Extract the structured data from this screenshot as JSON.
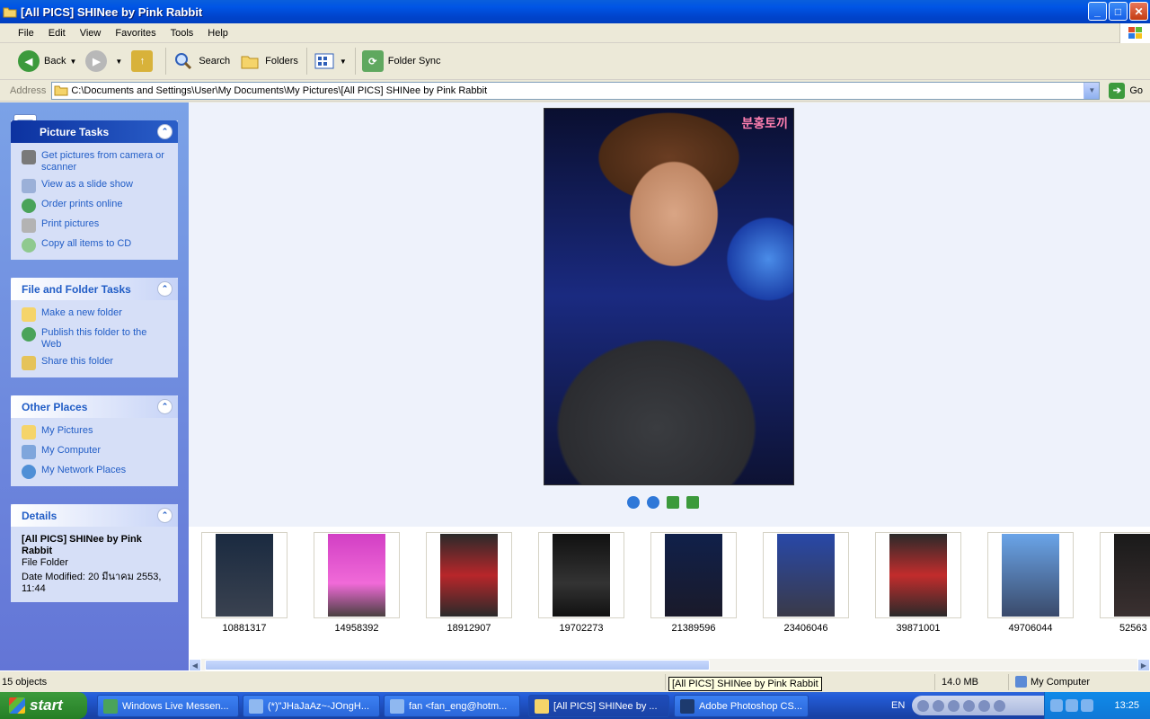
{
  "window": {
    "title": "[All PICS] SHINee by Pink Rabbit"
  },
  "menu": [
    "File",
    "Edit",
    "View",
    "Favorites",
    "Tools",
    "Help"
  ],
  "toolbar": {
    "back": "Back",
    "search": "Search",
    "folders": "Folders",
    "folder_sync": "Folder Sync"
  },
  "address": {
    "label": "Address",
    "path": "C:\\Documents and Settings\\User\\My Documents\\My Pictures\\[All PICS] SHINee by Pink Rabbit",
    "go": "Go"
  },
  "tasks": {
    "picture": {
      "title": "Picture Tasks",
      "items": [
        "Get pictures from camera or scanner",
        "View as a slide show",
        "Order prints online",
        "Print pictures",
        "Copy all items to CD"
      ]
    },
    "file_folder": {
      "title": "File and Folder Tasks",
      "items": [
        "Make a new folder",
        "Publish this folder to the Web",
        "Share this folder"
      ]
    },
    "other": {
      "title": "Other Places",
      "items": [
        "My Pictures",
        "My Computer",
        "My Network Places"
      ]
    },
    "details": {
      "title": "Details",
      "name": "[All PICS] SHINee by Pink Rabbit",
      "type": "File Folder",
      "modified": "Date Modified: 20 มีนาคม 2553, 11:44"
    }
  },
  "preview": {
    "watermark": "분홍토끼"
  },
  "thumbnails": [
    "10881317",
    "14958392",
    "18912907",
    "19702273",
    "21389596",
    "23406046",
    "39871001",
    "49706044",
    "52563"
  ],
  "status": {
    "objects": "15 objects",
    "tooltip": "[All PICS] SHINee by Pink Rabbit",
    "size": "14.0 MB",
    "location": "My Computer"
  },
  "taskbar": {
    "start": "start",
    "buttons": [
      "Windows Live Messen...",
      "(*)\"JHaJaAz~-JOngH...",
      "fan <fan_eng@hotm...",
      "[All PICS] SHINee by ...",
      "Adobe Photoshop CS..."
    ],
    "lang": "EN",
    "clock": "13:25"
  },
  "colors": {
    "title_blue": "#0055e5",
    "task_link": "#215dc6",
    "start_green": "#3c9a3c"
  }
}
